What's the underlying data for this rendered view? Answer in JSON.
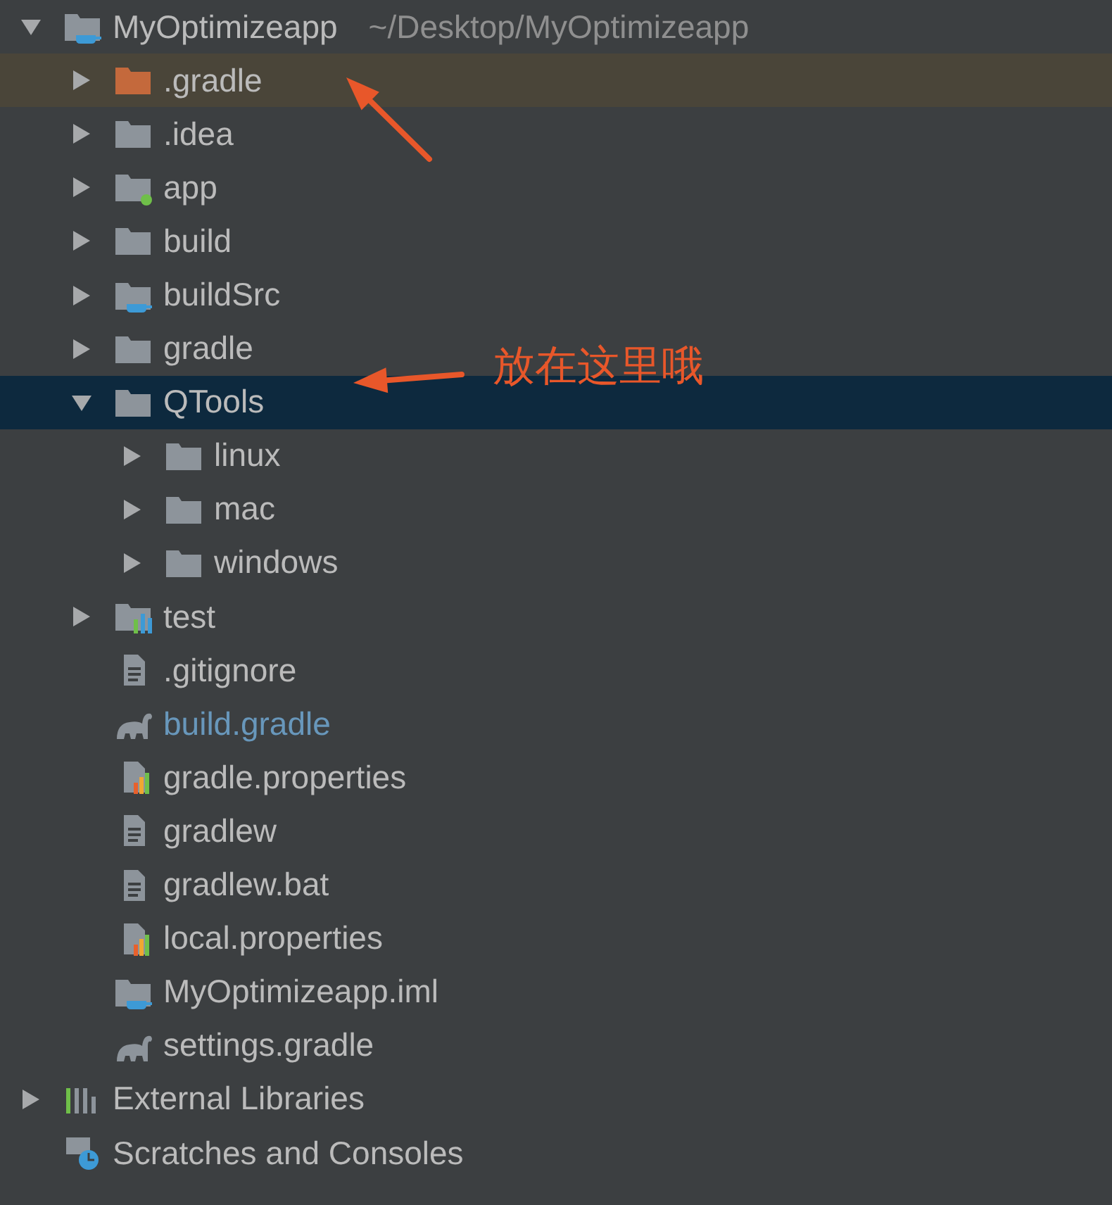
{
  "project_tree": [
    {
      "name": "MyOptimizeapp",
      "path": "~/Desktop/MyOptimizeapp",
      "kind": "module",
      "expanded": true,
      "selected": false,
      "highlighted": false,
      "modified": false,
      "children": [
        {
          "name": ".gradle",
          "kind": "excluded-folder",
          "expanded": false,
          "selected": false,
          "highlighted": true,
          "modified": false
        },
        {
          "name": ".idea",
          "kind": "folder",
          "expanded": false,
          "selected": false,
          "highlighted": false,
          "modified": false
        },
        {
          "name": "app",
          "kind": "app-folder",
          "expanded": false,
          "selected": false,
          "highlighted": false,
          "modified": false
        },
        {
          "name": "build",
          "kind": "folder",
          "expanded": false,
          "selected": false,
          "highlighted": false,
          "modified": false
        },
        {
          "name": "buildSrc",
          "kind": "module",
          "expanded": false,
          "selected": false,
          "highlighted": false,
          "modified": false
        },
        {
          "name": "gradle",
          "kind": "folder",
          "expanded": false,
          "selected": false,
          "highlighted": false,
          "modified": false
        },
        {
          "name": "QTools",
          "kind": "folder",
          "expanded": true,
          "selected": true,
          "highlighted": false,
          "modified": false,
          "children": [
            {
              "name": "linux",
              "kind": "folder",
              "expanded": false,
              "selected": false,
              "highlighted": false,
              "modified": false
            },
            {
              "name": "mac",
              "kind": "folder",
              "expanded": false,
              "selected": false,
              "highlighted": false,
              "modified": false
            },
            {
              "name": "windows",
              "kind": "folder",
              "expanded": false,
              "selected": false,
              "highlighted": false,
              "modified": false
            }
          ]
        },
        {
          "name": "test",
          "kind": "test-folder",
          "expanded": false,
          "selected": false,
          "highlighted": false,
          "modified": false
        },
        {
          "name": ".gitignore",
          "kind": "file",
          "selected": false,
          "highlighted": false,
          "modified": false
        },
        {
          "name": "build.gradle",
          "kind": "gradle",
          "selected": false,
          "highlighted": false,
          "modified": true
        },
        {
          "name": "gradle.properties",
          "kind": "properties",
          "selected": false,
          "highlighted": false,
          "modified": false
        },
        {
          "name": "gradlew",
          "kind": "file",
          "selected": false,
          "highlighted": false,
          "modified": false
        },
        {
          "name": "gradlew.bat",
          "kind": "file",
          "selected": false,
          "highlighted": false,
          "modified": false
        },
        {
          "name": "local.properties",
          "kind": "properties",
          "selected": false,
          "highlighted": false,
          "modified": false
        },
        {
          "name": "MyOptimizeapp.iml",
          "kind": "iml",
          "selected": false,
          "highlighted": false,
          "modified": false
        },
        {
          "name": "settings.gradle",
          "kind": "gradle",
          "selected": false,
          "highlighted": false,
          "modified": false
        }
      ]
    },
    {
      "name": "External Libraries",
      "kind": "libraries",
      "expanded": false,
      "selected": false,
      "highlighted": false,
      "modified": false
    },
    {
      "name": "Scratches and Consoles",
      "kind": "scratches",
      "selected": false,
      "highlighted": false,
      "modified": false
    }
  ],
  "annotations": [
    {
      "kind": "arrow"
    },
    {
      "kind": "arrow"
    },
    {
      "kind": "note",
      "text": "放在这里哦"
    }
  ]
}
